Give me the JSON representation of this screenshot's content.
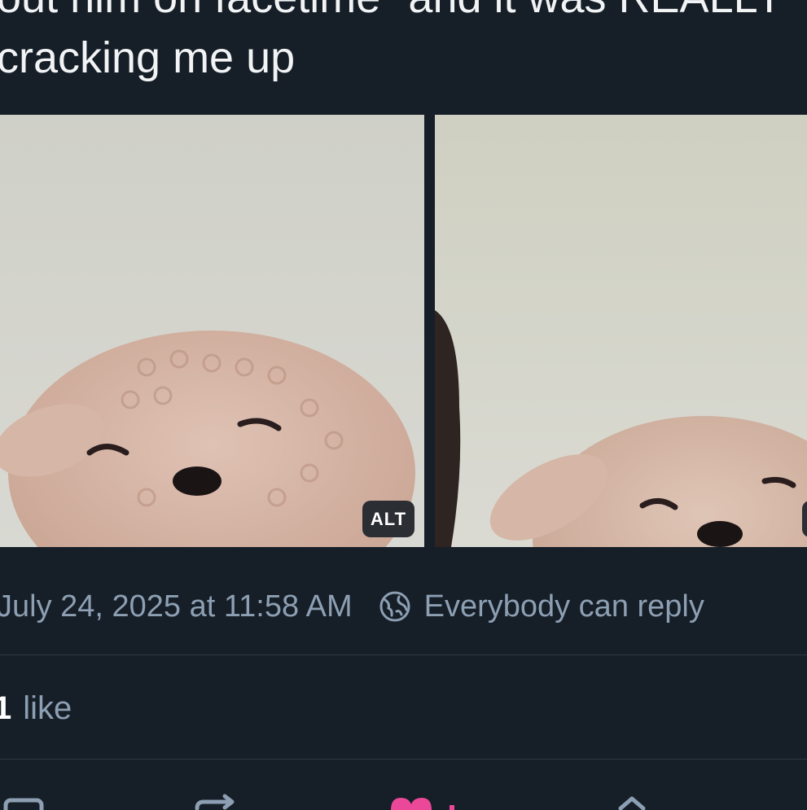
{
  "post": {
    "text_lines": [
      "out him on facetime\" and it was REALLY",
      "cracking me up"
    ]
  },
  "media": {
    "alt_badge": "ALT"
  },
  "meta": {
    "timestamp": "July 24, 2025 at 11:58 AM",
    "reply_setting": "Everybody can reply",
    "globe_icon": "globe-icon"
  },
  "stats": {
    "likes_count": "1",
    "likes_label": "like"
  },
  "actions": {
    "icons": [
      "reply-icon",
      "repost-icon",
      "like-icon",
      "share-icon"
    ],
    "like_color": "#ec4899"
  },
  "colors": {
    "background": "#161e27",
    "text": "#f1f3f5",
    "muted": "#8d9fb3",
    "divider": "#2c3846"
  }
}
